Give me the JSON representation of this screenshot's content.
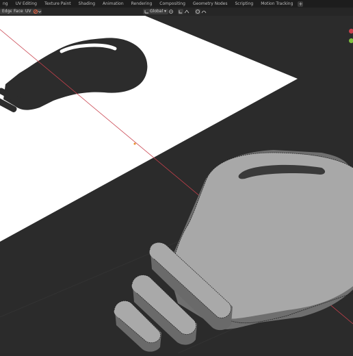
{
  "workspace_tabs": [
    "ng",
    "UV Editing",
    "Texture Paint",
    "Shading",
    "Animation",
    "Rendering",
    "Compositing",
    "Geometry Nodes",
    "Scripting",
    "Motion Tracking"
  ],
  "add_tab": "+",
  "header": {
    "select_edge": "Edge",
    "select_face": "Face",
    "uv_menu": "UV",
    "transform_orientation": "Global"
  },
  "colors": {
    "viewport_bg": "#2a2a2a",
    "reference_plane": "#ffffff",
    "bulb_silhouette": "#2c2c2c",
    "mesh_top": "#a7a7a7",
    "mesh_side": "#6f6f6f",
    "axis_x": "#c8404c",
    "gizmo_y": "#7fbf3f"
  }
}
